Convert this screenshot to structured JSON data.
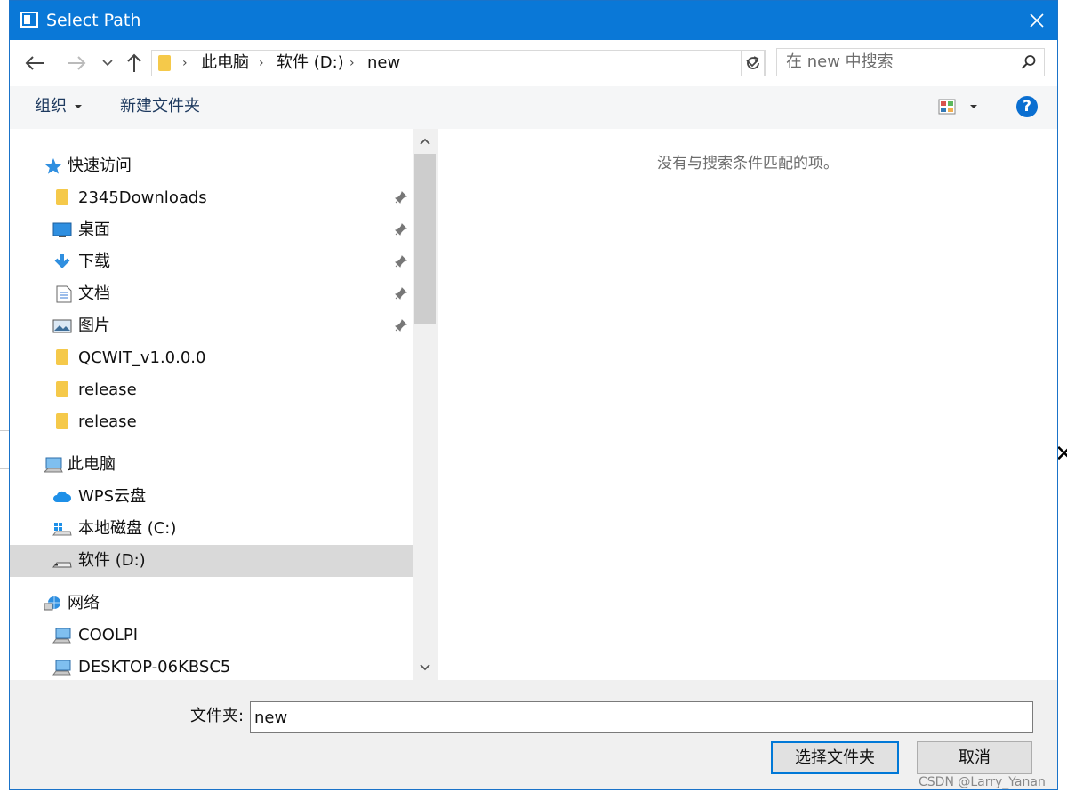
{
  "window": {
    "title": "Select Path"
  },
  "address_bar": {
    "breadcrumbs": [
      "此电脑",
      "软件 (D:)",
      "new"
    ]
  },
  "search": {
    "placeholder": "在 new 中搜索"
  },
  "toolbar": {
    "organize_label": "组织",
    "new_folder_label": "新建文件夹",
    "help_label": "?"
  },
  "nav": {
    "quick_access": {
      "label": "快速访问",
      "items": [
        {
          "label": "2345Downloads",
          "icon": "folder-icon",
          "pinned": true
        },
        {
          "label": "桌面",
          "icon": "desktop-icon",
          "pinned": true
        },
        {
          "label": "下载",
          "icon": "download-icon",
          "pinned": true
        },
        {
          "label": "文档",
          "icon": "document-icon",
          "pinned": true
        },
        {
          "label": "图片",
          "icon": "pictures-icon",
          "pinned": true
        },
        {
          "label": "QCWIT_v1.0.0.0",
          "icon": "folder-icon",
          "pinned": false
        },
        {
          "label": "release",
          "icon": "folder-icon",
          "pinned": false
        },
        {
          "label": "release",
          "icon": "folder-icon",
          "pinned": false
        }
      ]
    },
    "this_pc": {
      "label": "此电脑",
      "items": [
        {
          "label": "WPS云盘",
          "icon": "cloud-icon"
        },
        {
          "label": "本地磁盘 (C:)",
          "icon": "system-drive-icon"
        },
        {
          "label": "软件 (D:)",
          "icon": "drive-icon",
          "selected": true
        }
      ]
    },
    "network": {
      "label": "网络",
      "items": [
        {
          "label": "COOLPI",
          "icon": "computer-icon"
        },
        {
          "label": "DESKTOP-06KBSC5",
          "icon": "computer-icon"
        }
      ]
    }
  },
  "content": {
    "empty_message": "没有与搜索条件匹配的项。"
  },
  "footer": {
    "folder_label": "文件夹:",
    "folder_value": "new",
    "select_button": "选择文件夹",
    "cancel_button": "取消"
  },
  "watermark": "CSDN @Larry_Yanan",
  "colors": {
    "titlebar": "#0a78d7",
    "accent": "#0078d7",
    "selected_row": "#d9d9d9"
  }
}
